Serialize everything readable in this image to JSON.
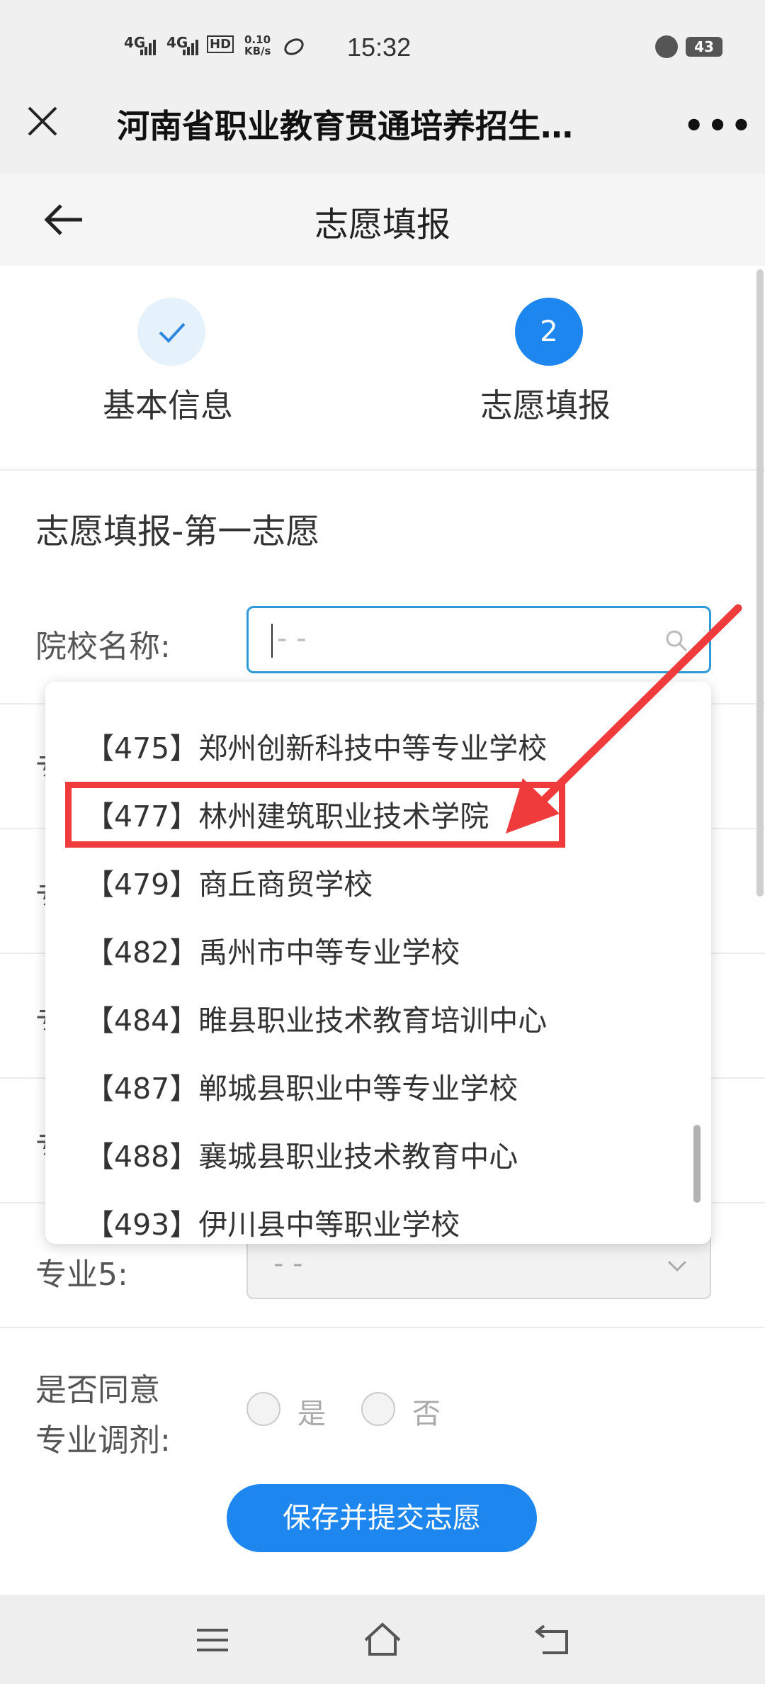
{
  "status_bar": {
    "signal1": "4G",
    "signal2": "4G",
    "hd": "HD",
    "net_speed": "0.10 KB/s",
    "time": "15:32",
    "battery": "43"
  },
  "title_bar": {
    "title": "河南省职业教育贯通培养招生…",
    "more": "•••"
  },
  "page_header": {
    "title": "志愿填报"
  },
  "steps": [
    {
      "label": "基本信息",
      "status": "done",
      "icon": "check-icon"
    },
    {
      "label": "志愿填报",
      "number": "2",
      "status": "active"
    }
  ],
  "form": {
    "section_title": "志愿填报-第一志愿",
    "school_label": "院校名称:",
    "school_placeholder": "- -",
    "major5_label": "专业5:",
    "major5_value": "- -",
    "adjust_label_line1": "是否同意",
    "adjust_label_line2": "专业调剂:",
    "adjust_yes": "是",
    "adjust_no": "否",
    "submit_label": "保存并提交志愿",
    "hidden_field_prefix": "专"
  },
  "dropdown": {
    "items": [
      "【475】郑州创新科技中等专业学校",
      "【477】林州建筑职业技术学院",
      "【479】商丘商贸学校",
      "【482】禹州市中等专业学校",
      "【484】睢县职业技术教育培训中心",
      "【487】郸城县职业中等专业学校",
      "【488】襄城县职业技术教育中心",
      "【493】伊川县中等职业学校"
    ],
    "highlighted_index": 1
  },
  "colors": {
    "accent": "#1d86ef",
    "annotation": "#ef3b3b",
    "focus_border": "#2e9bd6"
  }
}
